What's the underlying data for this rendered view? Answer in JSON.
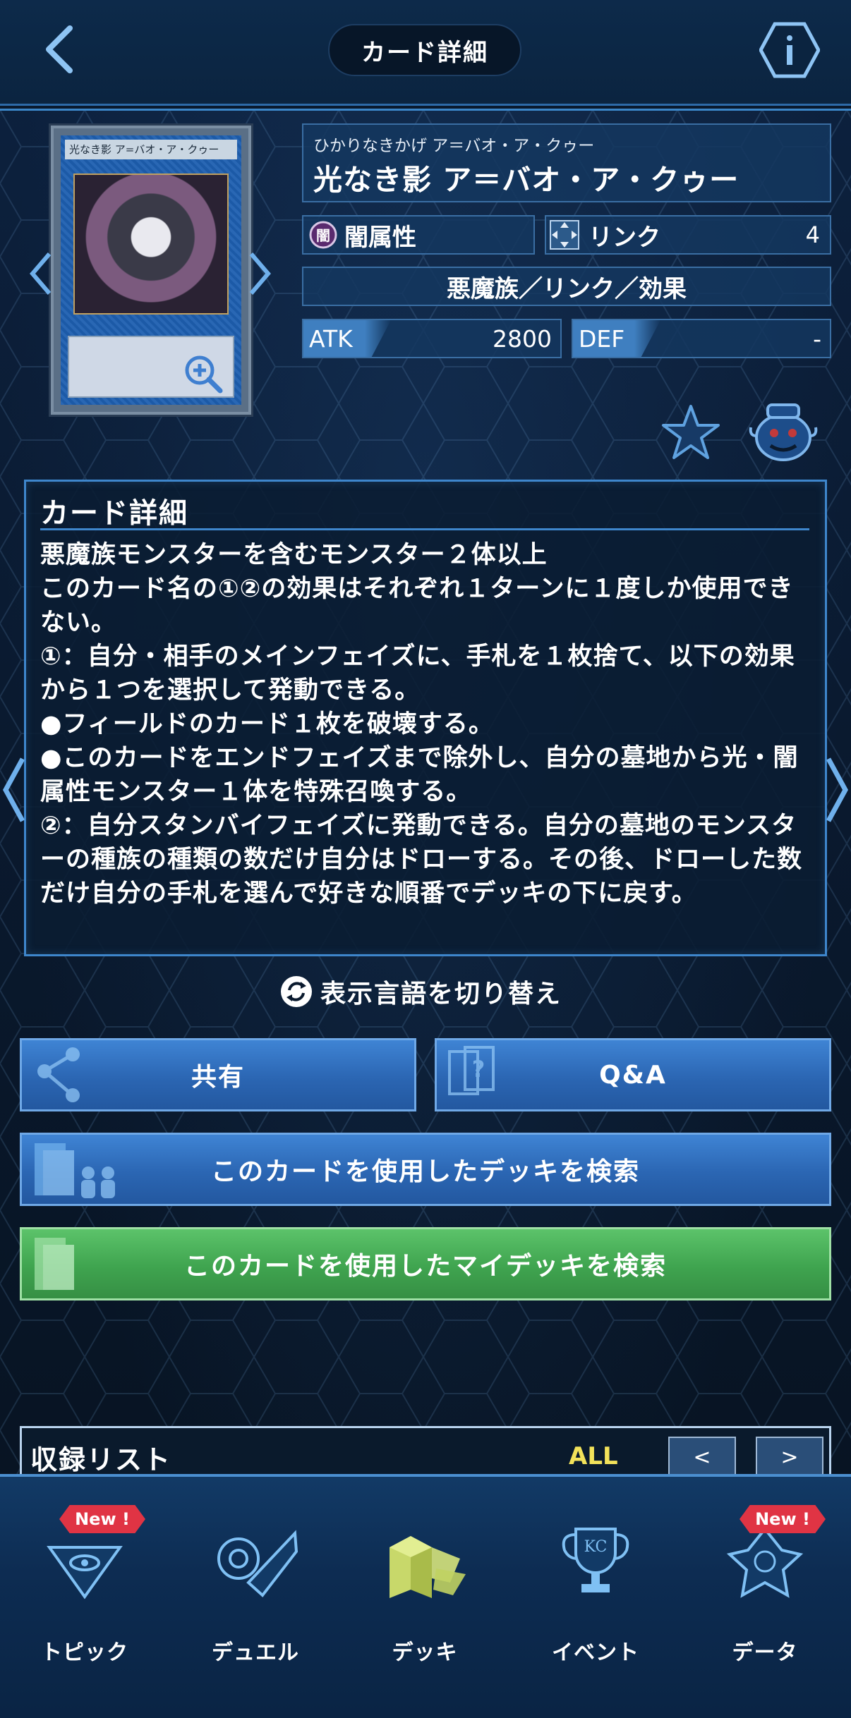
{
  "header": {
    "title": "カード詳細"
  },
  "card": {
    "image_name": "光なき影 ア=バオ・ア・クゥー",
    "ruby": "ひかりなきかげ ア＝バオ・ア・クゥー",
    "name": "光なき影 ア＝バオ・ア・クゥー",
    "attribute": "闇属性",
    "attribute_glyph": "闇",
    "card_type": "リンク",
    "link_value": "4",
    "race_line": "悪魔族／リンク／効果",
    "atk_label": "ATK",
    "atk_value": "2800",
    "def_label": "DEF",
    "def_value": "-"
  },
  "description": {
    "title": "カード詳細",
    "text": "悪魔族モンスターを含むモンスター２体以上\nこのカード名の①②の効果はそれぞれ１ターンに１度しか使用できない。\n①：自分・相手のメインフェイズに、手札を１枚捨て、以下の効果から１つを選択して発動できる。\n●フィールドのカード１枚を破壊する。\n●このカードをエンドフェイズまで除外し、自分の墓地から光・闇属性モンスター１体を特殊召喚する。\n②：自分スタンバイフェイズに発動できる。自分の墓地のモンスターの種族の種類の数だけ自分はドローする。その後、ドローした数だけ自分の手札を選んで好きな順番でデッキの下に戻す。"
  },
  "actions": {
    "language_toggle": "表示言語を切り替え",
    "share": "共有",
    "qa": "Q&A",
    "search_decks": "このカードを使用したデッキを検索",
    "search_my_decks": "このカードを使用したマイデッキを検索"
  },
  "recording_list": {
    "title": "収録リスト",
    "filter": "ALL",
    "prev": "<",
    "next": ">"
  },
  "bottom_nav": {
    "items": [
      {
        "label": "トピック",
        "icon": "pyramid-eye-icon",
        "badge": "New !"
      },
      {
        "label": "デュエル",
        "icon": "duel-disk-icon",
        "badge": ""
      },
      {
        "label": "デッキ",
        "icon": "deck-icon",
        "badge": ""
      },
      {
        "label": "イベント",
        "icon": "trophy-icon",
        "badge": ""
      },
      {
        "label": "データ",
        "icon": "monster-data-icon",
        "badge": "New !"
      }
    ]
  },
  "colors": {
    "accent_blue": "#3e86cc",
    "button_blue": "#2b66b3",
    "button_green": "#3fa44f",
    "badge_red": "#e03444",
    "filter_yellow": "#f2e25a"
  }
}
